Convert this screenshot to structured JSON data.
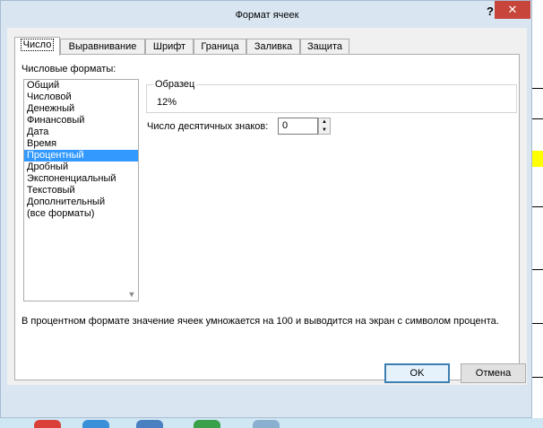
{
  "dialog": {
    "title": "Формат ячеек",
    "help_label": "?",
    "close_label": "✕",
    "tabs": [
      {
        "label": "Число",
        "active": true
      },
      {
        "label": "Выравнивание",
        "active": false
      },
      {
        "label": "Шрифт",
        "active": false
      },
      {
        "label": "Граница",
        "active": false
      },
      {
        "label": "Заливка",
        "active": false
      },
      {
        "label": "Защита",
        "active": false
      }
    ],
    "formats_label": "Числовые форматы:",
    "formats": [
      "Общий",
      "Числовой",
      "Денежный",
      "Финансовый",
      "Дата",
      "Время",
      "Процентный",
      "Дробный",
      "Экспоненциальный",
      "Текстовый",
      "Дополнительный",
      "(все форматы)"
    ],
    "selected_format": "Процентный",
    "sample": {
      "legend": "Образец",
      "value": "12%"
    },
    "decimals": {
      "label": "Число десятичных знаков:",
      "value": "0"
    },
    "description": "В процентном формате значение ячеек умножается на 100 и выводится на экран с символом процента.",
    "buttons": {
      "ok": "OK",
      "cancel": "Отмена"
    }
  },
  "colors": {
    "selection": "#3399ff",
    "close": "#c7453a",
    "dialog_frame": "#d9e6f2"
  }
}
